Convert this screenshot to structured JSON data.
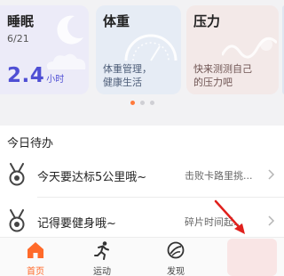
{
  "cards": {
    "sleep": {
      "title": "睡眠",
      "date": "6/21",
      "value": "2.4",
      "unit": "小时"
    },
    "weight": {
      "title": "体重",
      "desc_line1": "体重管理，",
      "desc_line2": "健康生活"
    },
    "stress": {
      "title": "压力",
      "desc_line1": "快来测测自己",
      "desc_line2": "的压力吧"
    }
  },
  "carousel": {
    "page_count": 3,
    "active_index": 0
  },
  "tasks": {
    "title": "今日待办",
    "items": [
      {
        "text": "今天要达标5公里哦~",
        "sub": "击败卡路里挑..."
      },
      {
        "text": "记得要健身哦~",
        "sub": "碎片时间起..."
      }
    ]
  },
  "nav": {
    "items": [
      {
        "label": "首页",
        "icon": "home-icon",
        "active": true
      },
      {
        "label": "运动",
        "icon": "runner-icon",
        "active": false
      },
      {
        "label": "发现",
        "icon": "discover-icon",
        "active": false
      }
    ]
  },
  "colors": {
    "accent": "#ff6a2a",
    "sleep_value": "#4f4fd4",
    "annotation_arrow": "#e0201c"
  }
}
